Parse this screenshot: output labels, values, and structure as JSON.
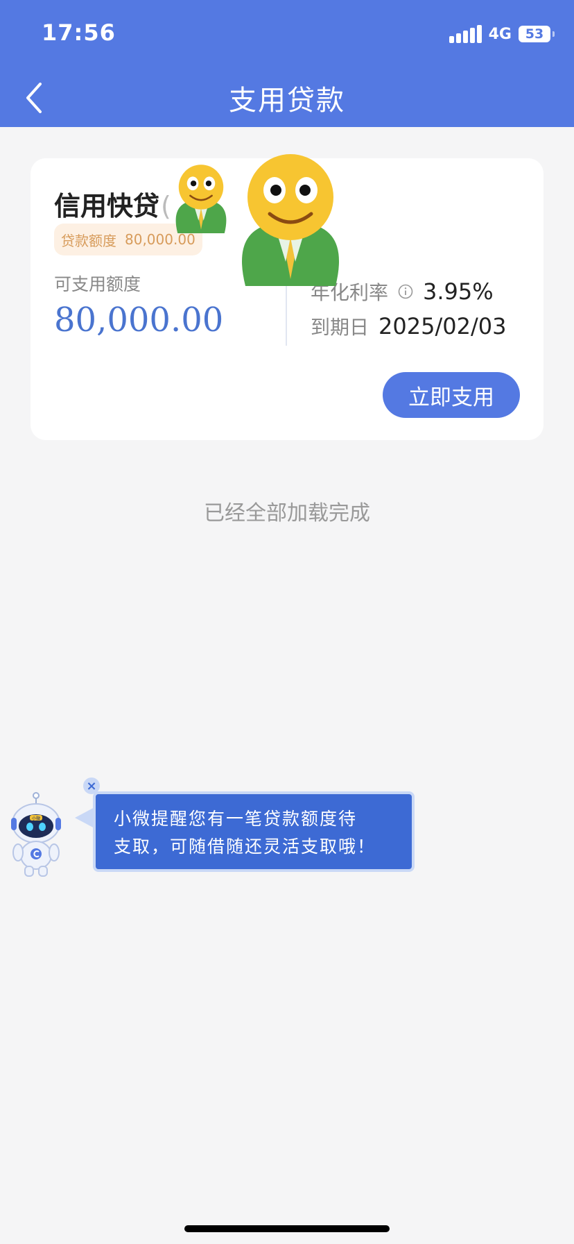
{
  "status_bar": {
    "time": "17:56",
    "network": "4G",
    "battery": "53"
  },
  "header": {
    "title": "支用贷款"
  },
  "loan_card": {
    "product_name": "信用快贷",
    "product_paren": "(",
    "limit_tag": {
      "label": "贷款额度",
      "value": "80,000.00"
    },
    "available_label": "可支用额度",
    "available_value": "80,000.00",
    "rate_label": "年化利率",
    "rate_value": "3.95%",
    "due_label": "到期日",
    "due_value": "2025/02/03",
    "use_button_label": "立即支用",
    "emoji": "smiling face with green tie"
  },
  "list_status": "已经全部加载完成",
  "assistant": {
    "robot_label": "小微",
    "message_line1": "小微提醒您有一笔贷款额度待",
    "message_line2": "支取，可随借随还灵活支取哦！",
    "close_label": "×"
  },
  "colors": {
    "primary": "#5479e2",
    "amount": "#4a74cf",
    "tag_bg": "#fdf0e3",
    "tag_text": "#d79b5a"
  }
}
